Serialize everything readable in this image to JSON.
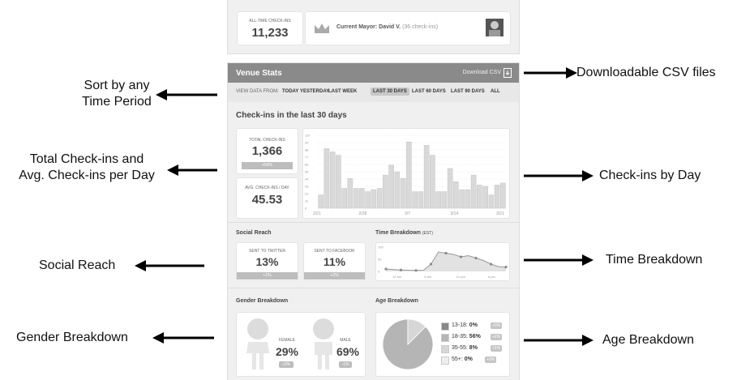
{
  "top": {
    "all_time_label": "ALL-TIME CHECK-INS",
    "all_time_value": "11,233",
    "mayor_label": "Current Mayor:",
    "mayor_name": "David V.",
    "mayor_checkins": "(36 check-ins)"
  },
  "venue_stats": {
    "title": "Venue Stats",
    "download": "Download CSV",
    "view_from": "VIEW DATA FROM:",
    "periods": [
      "TODAY",
      "YESTERDAY",
      "LAST WEEK",
      "LAST 30 DAYS",
      "LAST 60 DAYS",
      "LAST 90 DAYS",
      "ALL"
    ],
    "selected_period": "LAST 30 DAYS"
  },
  "checkins": {
    "heading": "Check-ins in the last 30 days",
    "total_label": "TOTAL CHECK-INS",
    "total_value": "1,366",
    "total_change": "+54%",
    "avg_label": "AVG. CHECK-INS / DAY",
    "avg_value": "45.53"
  },
  "social": {
    "title": "Social Reach",
    "twitter_label": "SENT TO TWITTER",
    "twitter_value": "13%",
    "twitter_change": "+1%",
    "facebook_label": "SENT TO FACEBOOK",
    "facebook_value": "11%",
    "facebook_change": "+2%"
  },
  "time_breakdown": {
    "title": "Time Breakdown",
    "tz": "(EST)"
  },
  "gender": {
    "title": "Gender Breakdown",
    "female_label": "FEMALE",
    "female_value": "29%",
    "female_change": "+2%",
    "male_label": "MALE",
    "male_value": "69%",
    "male_change": "-1%"
  },
  "age": {
    "title": "Age Breakdown",
    "rows": [
      {
        "label": "13-18:",
        "value": "0%",
        "change": "+0%",
        "color": "#888888"
      },
      {
        "label": "18-35:",
        "value": "56%",
        "change": "+2%",
        "color": "#b5b5b5"
      },
      {
        "label": "35-55:",
        "value": "8%",
        "change": "+1%",
        "color": "#d6d6d6"
      },
      {
        "label": "55+:",
        "value": "0%",
        "change": "+0%",
        "color": "#eeeeee"
      }
    ]
  },
  "annotations": {
    "sort": [
      "Sort by any",
      "Time Period"
    ],
    "total": [
      "Total Check-ins and",
      "Avg. Check-ins per Day"
    ],
    "social": "Social Reach",
    "gender": "Gender Breakdown",
    "csv": "Downloadable CSV files",
    "by_day": "Check-ins by Day",
    "time": "Time Breakdown",
    "age": "Age Breakdown"
  },
  "chart_data": [
    {
      "type": "bar",
      "title": "Check-ins in the last 30 days",
      "y_ticks": [
        0,
        11,
        22,
        33,
        44,
        55,
        66,
        77,
        88,
        99,
        110
      ],
      "x_tick_labels": [
        "2/21",
        "2/28",
        "3/7",
        "3/14",
        "3/21"
      ],
      "ylim": [
        0,
        110
      ],
      "values": [
        20,
        90,
        85,
        80,
        30,
        45,
        30,
        30,
        25,
        28,
        30,
        50,
        65,
        55,
        45,
        100,
        25,
        25,
        95,
        80,
        25,
        25,
        60,
        40,
        28,
        28,
        50,
        35,
        33,
        20,
        35,
        38
      ]
    },
    {
      "type": "line",
      "title": "Time Breakdown",
      "y_ticks": [
        0,
        50,
        100
      ],
      "x_tick_labels": [
        "12 am",
        "6 am",
        "12 pm",
        "6 pm"
      ],
      "ylim": [
        0,
        100
      ],
      "values": [
        10,
        8,
        6,
        5,
        4,
        5,
        30,
        80,
        75,
        70,
        60,
        65,
        55,
        45,
        30,
        20,
        18
      ]
    },
    {
      "type": "pie",
      "title": "Age Breakdown",
      "labels": [
        "13-18",
        "18-35",
        "35-55",
        "55+"
      ],
      "values": [
        0,
        56,
        8,
        0
      ]
    }
  ]
}
